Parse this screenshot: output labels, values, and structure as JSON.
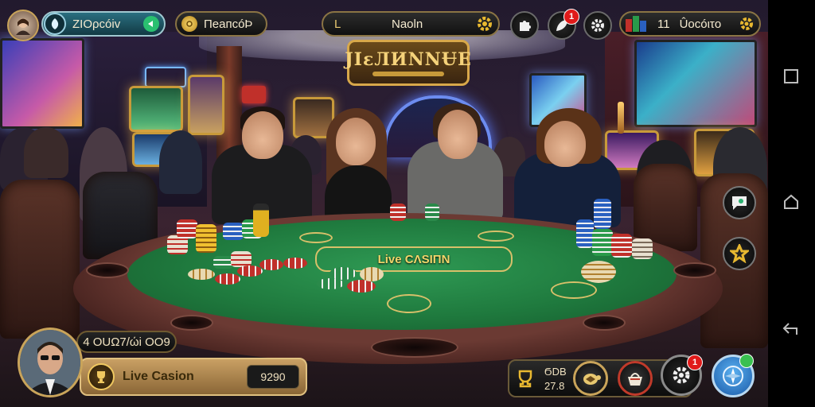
{
  "top_bar": {
    "profile": {
      "balance": "ΖΙΟρcóiv"
    },
    "currency": {
      "amount": "ПeaпcóÞ"
    },
    "room": {
      "title": "Naoln",
      "prefix": "L"
    },
    "notifications": {
      "badge": "1"
    },
    "wallet": {
      "count": "11",
      "label": "Ûocóιτo"
    }
  },
  "scene": {
    "sign_text": "JIɛЛИNNɄE",
    "felt_label": "Live CΛSIПN"
  },
  "bottom_left": {
    "score": "4 OUΩ7/ώi OO9",
    "game_name": "Live Casion",
    "game_value": "9290"
  },
  "bottom_right": {
    "stat_top": "ϬDB",
    "stat_bottom": "27.8",
    "settings_badge": "1"
  },
  "colors": {
    "accent_gold": "#c9a45a",
    "felt_green": "#1f7a3e",
    "badge_red": "#e01a1a",
    "pill_teal": "#1e6d7a",
    "compass_blue": "#1a7ad0"
  },
  "icons": [
    "avatar-icon",
    "leaf-icon",
    "arrow-icon",
    "coin-icon",
    "gear-icon",
    "puzzle-icon",
    "leaf-notify-icon",
    "settings-icon",
    "chips-icon",
    "chat-icon",
    "star-icon",
    "trophy-icon",
    "turtle-icon",
    "basket-icon",
    "compass-icon",
    "square-nav-icon",
    "home-nav-icon",
    "back-nav-icon"
  ]
}
